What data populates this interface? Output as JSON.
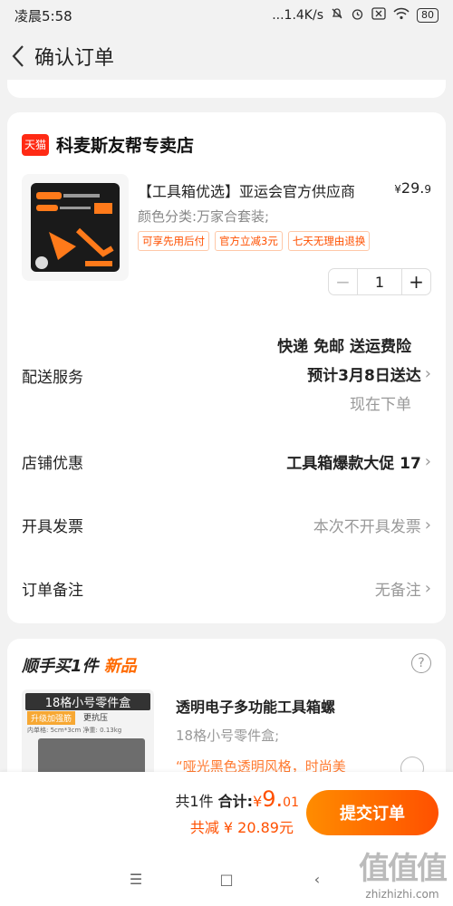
{
  "status_bar": {
    "time": "凌晨5:58",
    "speed": "...1.4K/s",
    "battery": "80"
  },
  "header": {
    "title": "确认订单"
  },
  "store": {
    "logo": "天猫",
    "name": "科麦斯友帮专卖店"
  },
  "product": {
    "title": "【工具箱优选】亚运会官方供应商",
    "price_symbol": "¥",
    "price_int": "29.",
    "price_dec": "9",
    "spec": "颜色分类:万家合套装;",
    "tags": [
      "可享先用后付",
      "官方立减3元",
      "七天无理由退换"
    ],
    "quantity": "1",
    "minus": "−",
    "plus": "+"
  },
  "delivery": {
    "label": "配送服务",
    "line1": "快递 免邮 送运费险",
    "line2": "预计3月8日送达",
    "line3": "现在下单"
  },
  "store_discount": {
    "label": "店铺优惠",
    "value": "工具箱爆款大促 17"
  },
  "invoice": {
    "label": "开具发票",
    "value": "本次不开具发票"
  },
  "note": {
    "label": "订单备注",
    "value": "无备注"
  },
  "upsell": {
    "title": "顺手买1件",
    "new_label": "新品",
    "help": "?",
    "img_caption": "18格小号零件盒",
    "img_badge1": "升级加强筋",
    "img_badge2": "更抗压",
    "img_specs": "内单格: 5cm*3cm  净重: 0.13kg",
    "name": "透明电子多功能工具箱螺",
    "spec": "18格小号零件盒;",
    "desc": "“哑光黑色透明风格，时尚美"
  },
  "footer": {
    "count": "共1件",
    "total_label": "合计:",
    "total_symbol": "¥",
    "total_int": "9.",
    "total_dec": "01",
    "discount": "共减 ¥ 20.89元",
    "submit": "提交订单"
  },
  "system_nav": {
    "menu": "☰",
    "home": "□",
    "back": "‹"
  },
  "watermark": {
    "logo": "值值值",
    "url": "zhizhizhi.com"
  },
  "colors": {
    "accent": "#ff5000",
    "tmall": "#ff2a14",
    "bg": "#f2f2f2"
  }
}
